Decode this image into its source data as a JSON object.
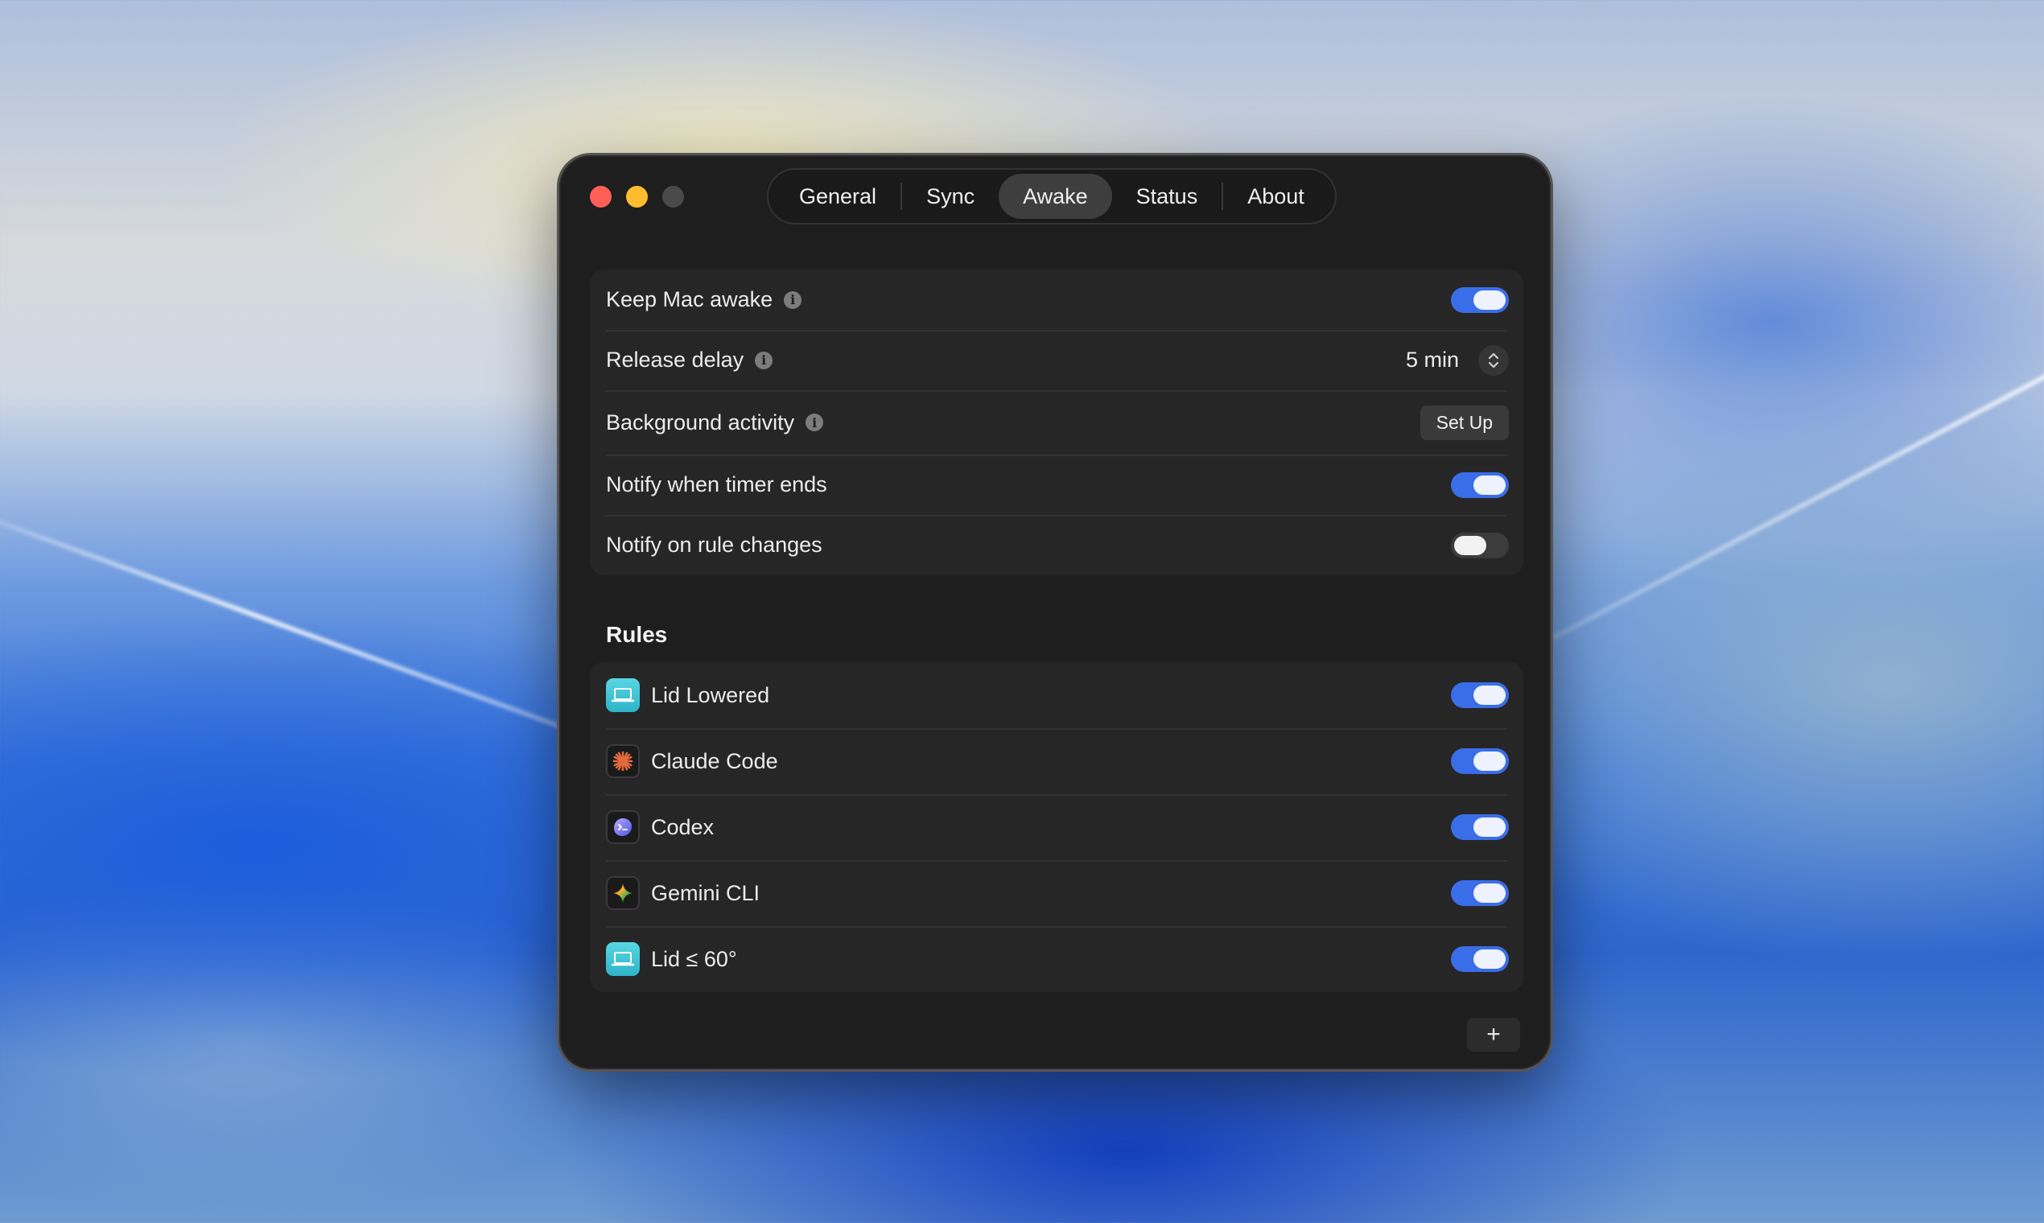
{
  "window": {
    "traffic_lights": [
      "close",
      "minimize",
      "zoom"
    ]
  },
  "tabs": [
    {
      "label": "General",
      "active": false
    },
    {
      "label": "Sync",
      "active": false
    },
    {
      "label": "Awake",
      "active": true
    },
    {
      "label": "Status",
      "active": false
    },
    {
      "label": "About",
      "active": false
    }
  ],
  "settings": {
    "keep_awake": {
      "label": "Keep Mac awake",
      "info_icon": "info-icon",
      "on": true
    },
    "release_delay": {
      "label": "Release delay",
      "info_icon": "info-icon",
      "value": "5 min"
    },
    "background_activity": {
      "label": "Background activity",
      "info_icon": "info-icon",
      "button": "Set Up"
    },
    "notify_timer": {
      "label": "Notify when timer ends",
      "on": true
    },
    "notify_rules": {
      "label": "Notify on rule changes",
      "on": false
    }
  },
  "rules": {
    "title": "Rules",
    "items": [
      {
        "label": "Lid Lowered",
        "icon": "laptop-icon",
        "on": true
      },
      {
        "label": "Claude Code",
        "icon": "claude-icon",
        "on": true
      },
      {
        "label": "Codex",
        "icon": "codex-icon",
        "on": true
      },
      {
        "label": "Gemini CLI",
        "icon": "gemini-icon",
        "on": true
      },
      {
        "label": "Lid ≤ 60°",
        "icon": "laptop-icon",
        "on": true
      }
    ]
  },
  "add_button": "+",
  "colors": {
    "accent": "#3a6ee8",
    "window_bg": "#1e1e1e",
    "group_bg": "#262626",
    "close": "#ff5f57",
    "minimize": "#febc2e"
  }
}
